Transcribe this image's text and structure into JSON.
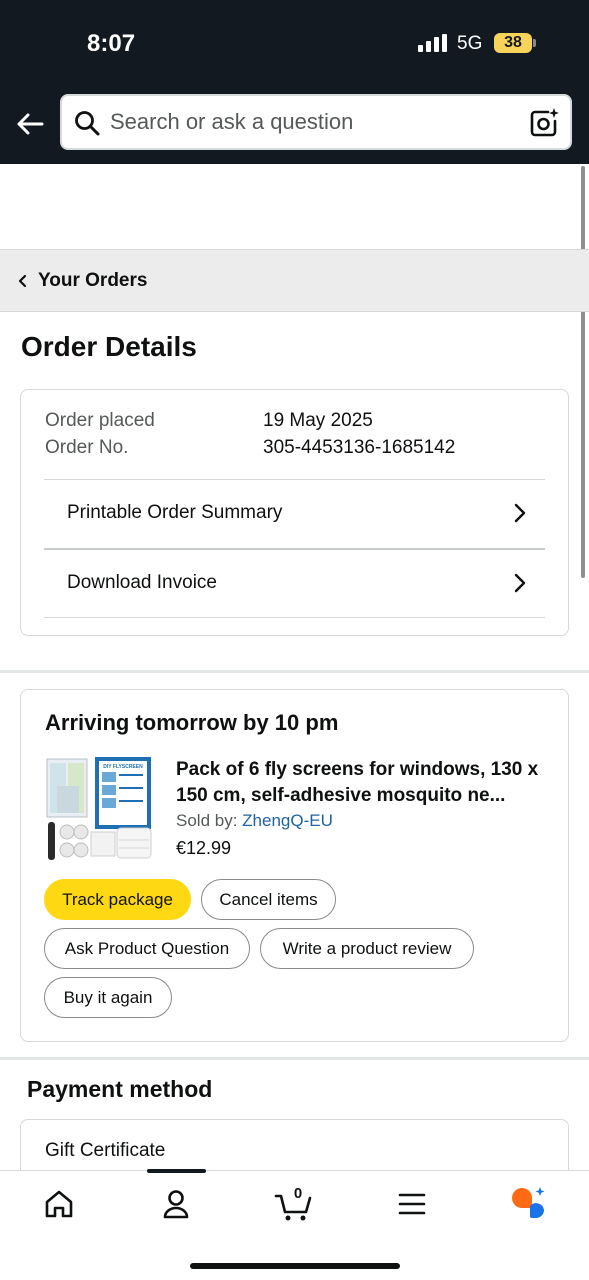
{
  "status_bar": {
    "time": "8:07",
    "network": "5G",
    "battery": "38"
  },
  "search": {
    "placeholder": "Search or ask a question"
  },
  "breadcrumb": {
    "label": "Your Orders"
  },
  "page": {
    "title": "Order Details"
  },
  "order_info": {
    "placed_label": "Order placed",
    "placed_value": "19 May 2025",
    "number_label": "Order No.",
    "number_value": "305-4453136-1685142",
    "links": [
      {
        "label": "Printable Order Summary"
      },
      {
        "label": "Download Invoice"
      }
    ]
  },
  "shipment": {
    "arrival": "Arriving tomorrow by 10 pm",
    "product_title": "Pack of 6 fly screens for windows, 130 x 150 cm, self-adhesive mosquito ne...",
    "sold_by_label": "Sold by:",
    "seller": "ZhengQ-EU",
    "price": "€12.99",
    "thumb_text": "DIY FLYSCREEN",
    "actions": [
      {
        "label": "Track package",
        "style": "primary"
      },
      {
        "label": "Cancel items"
      },
      {
        "label": "Ask Product Question"
      },
      {
        "label": "Write a product review"
      },
      {
        "label": "Buy it again"
      }
    ]
  },
  "payment": {
    "title": "Payment method",
    "method": "Gift Certificate"
  },
  "tab_bar": {
    "items": [
      {
        "icon": "home-icon"
      },
      {
        "icon": "account-icon"
      },
      {
        "icon": "cart-icon"
      },
      {
        "icon": "menu-icon"
      },
      {
        "icon": "rufus-assistant-icon"
      }
    ],
    "cart_count": "0"
  },
  "colors": {
    "header_bg": "#131921",
    "primary_button": "#ffd814",
    "link": "#2162a1",
    "battery": "#f7d35a",
    "assistant_orange": "#ff6a13",
    "assistant_blue": "#1a73e8"
  }
}
